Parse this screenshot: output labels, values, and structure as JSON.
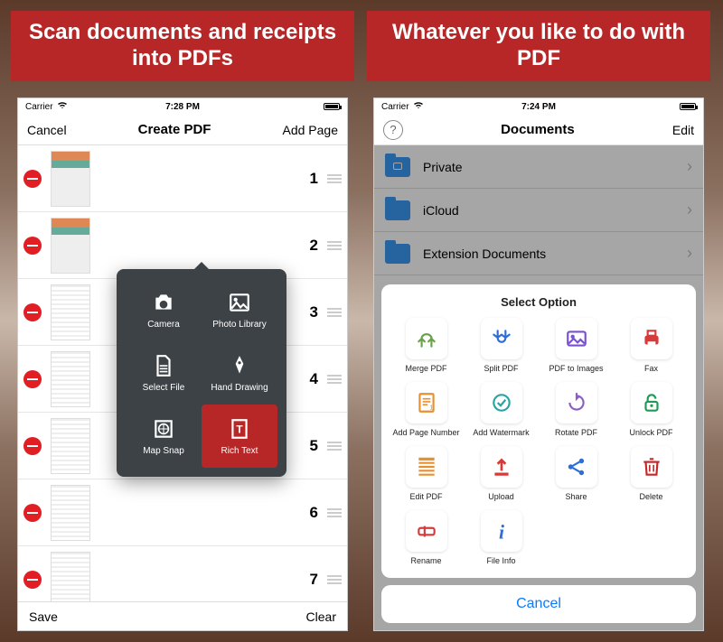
{
  "left": {
    "banner": "Scan documents and receipts into PDFs",
    "status": {
      "carrier": "Carrier",
      "time": "7:28 PM"
    },
    "nav": {
      "left": "Cancel",
      "title": "Create PDF",
      "right": "Add Page"
    },
    "pages": [
      "1",
      "2",
      "3",
      "4",
      "5",
      "6",
      "7"
    ],
    "bottom": {
      "left": "Save",
      "right": "Clear"
    },
    "popover": {
      "items": [
        {
          "id": "camera",
          "label": "Camera"
        },
        {
          "id": "photo-library",
          "label": "Photo Library"
        },
        {
          "id": "select-file",
          "label": "Select File"
        },
        {
          "id": "hand-drawing",
          "label": "Hand Drawing"
        },
        {
          "id": "map-snap",
          "label": "Map Snap"
        },
        {
          "id": "rich-text",
          "label": "Rich Text",
          "highlight": true
        }
      ]
    }
  },
  "right": {
    "banner": "Whatever you like to do with PDF",
    "status": {
      "carrier": "Carrier",
      "time": "7:24 PM"
    },
    "nav": {
      "title": "Documents",
      "right": "Edit"
    },
    "folders": [
      {
        "id": "private",
        "label": "Private"
      },
      {
        "id": "icloud",
        "label": "iCloud"
      },
      {
        "id": "ext",
        "label": "Extension Documents"
      }
    ],
    "sheet": {
      "title": "Select Option",
      "cancel": "Cancel",
      "options": [
        {
          "id": "merge",
          "label": "Merge PDF",
          "color": "#6aa24a"
        },
        {
          "id": "split",
          "label": "Split PDF",
          "color": "#2d6fd6"
        },
        {
          "id": "toimages",
          "label": "PDF to Images",
          "color": "#7a4fd1"
        },
        {
          "id": "fax",
          "label": "Fax",
          "color": "#d63a3a"
        },
        {
          "id": "pagenum",
          "label": "Add Page Number",
          "color": "#e8902e"
        },
        {
          "id": "watermark",
          "label": "Add Watermark",
          "color": "#2aa3a3"
        },
        {
          "id": "rotate",
          "label": "Rotate PDF",
          "color": "#8a5fc3"
        },
        {
          "id": "unlock",
          "label": "Unlock PDF",
          "color": "#1d9b55"
        },
        {
          "id": "editpdf",
          "label": "Edit PDF",
          "color": "#e8902e"
        },
        {
          "id": "upload",
          "label": "Upload",
          "color": "#d63a3a"
        },
        {
          "id": "share",
          "label": "Share",
          "color": "#2d6fd6"
        },
        {
          "id": "delete",
          "label": "Delete",
          "color": "#c62828"
        },
        {
          "id": "rename",
          "label": "Rename",
          "color": "#d63a3a"
        },
        {
          "id": "fileinfo",
          "label": "File Info",
          "color": "#2d6fd6"
        }
      ]
    }
  }
}
